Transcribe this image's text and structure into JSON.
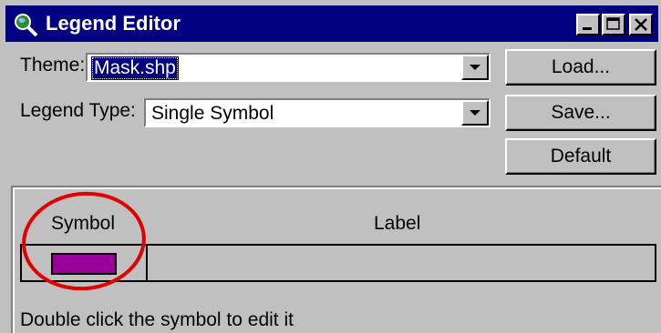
{
  "window": {
    "title": "Legend Editor",
    "icon": "globe-magnifier-icon",
    "controls": [
      "minimize-icon",
      "maximize-icon",
      "close-icon"
    ]
  },
  "theme": {
    "label": "Theme:",
    "value": "Mask.shp"
  },
  "legend_type": {
    "label": "Legend Type:",
    "value": "Single Symbol"
  },
  "buttons": {
    "load": "Load...",
    "save": "Save...",
    "default": "Default"
  },
  "table": {
    "columns": [
      "Symbol",
      "Label"
    ],
    "rows": [
      {
        "symbol_color": "#990099",
        "label": ""
      }
    ]
  },
  "hint": "Double click the symbol to edit it",
  "colors": {
    "title_bar": "#000080",
    "face": "#c0c0c0",
    "selection": "#000080",
    "symbol": "#990099",
    "annotation_circle": "#e00000"
  }
}
